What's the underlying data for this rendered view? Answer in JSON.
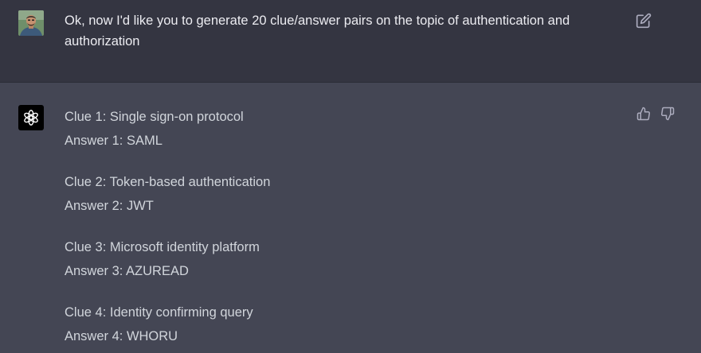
{
  "user_message": {
    "text": "Ok, now I'd like you to generate 20 clue/answer pairs on the topic of authentication and authorization"
  },
  "assistant_message": {
    "pairs": [
      {
        "clue": "Clue 1: Single sign-on protocol",
        "answer": "Answer 1: SAML"
      },
      {
        "clue": "Clue 2: Token-based authentication",
        "answer": "Answer 2: JWT"
      },
      {
        "clue": "Clue 3: Microsoft identity platform",
        "answer": "Answer 3: AZUREAD"
      },
      {
        "clue": "Clue 4: Identity confirming query",
        "answer": "Answer 4: WHORU"
      }
    ]
  },
  "icons": {
    "edit": "edit-icon",
    "thumbs_up": "thumbs-up-icon",
    "thumbs_down": "thumbs-down-icon",
    "assistant_logo": "openai-logo-icon",
    "user_avatar": "user-avatar"
  },
  "colors": {
    "user_bg": "#343541",
    "assistant_bg": "#444654",
    "user_text": "#ececf1",
    "assistant_text": "#d1d5db",
    "icon": "#acacbe"
  }
}
